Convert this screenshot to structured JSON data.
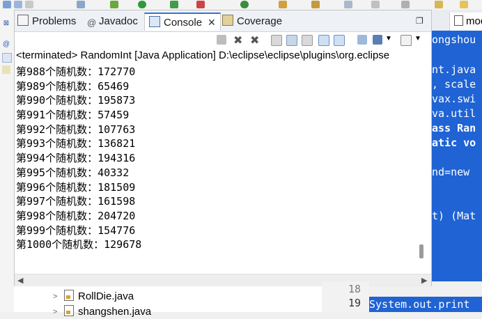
{
  "tabs": [
    {
      "label": "Problems",
      "icon": "problems-icon"
    },
    {
      "label": "Javadoc",
      "icon": "at-icon"
    },
    {
      "label": "Console",
      "icon": "console-icon"
    },
    {
      "label": "Coverage",
      "icon": "coverage-icon"
    }
  ],
  "console": {
    "status": "<terminated> RandomInt [Java Application] D:\\eclipse\\eclipse\\plugins\\org.eclipse",
    "lines": [
      "第988个随机数：172770",
      "第989个随机数：65469",
      "第990个随机数：195873",
      "第991个随机数：57459",
      "第992个随机数：107763",
      "第993个随机数：136821",
      "第994个随机数：194316",
      "第995个随机数：40332",
      "第996个随机数：181509",
      "第997个随机数：161598",
      "第998个随机数：204720",
      "第999个随机数：154776",
      "第1000个随机数：129678"
    ]
  },
  "tree": {
    "items": [
      "RollDie.java",
      "shangshen.java"
    ]
  },
  "editor": {
    "tab_label": "moc",
    "code_lines": [
      "ongshou",
      "",
      "nt.java",
      ", scale",
      "vax.swi",
      "va.util",
      "ass Ran",
      "atic vo",
      "",
      "nd=new ",
      "",
      "",
      "t) (Mat"
    ],
    "line_numbers": [
      "18",
      "19"
    ],
    "bottom_line": "System.out.print"
  }
}
